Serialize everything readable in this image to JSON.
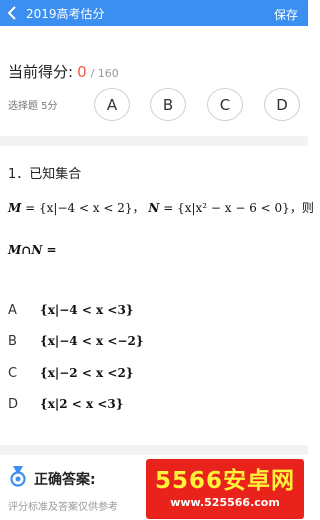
{
  "header": {
    "title": "2019高考估分",
    "save_label": "保存",
    "back_icon": "chevron-left-icon"
  },
  "score": {
    "label": "当前得分:",
    "value": "0",
    "total": "/ 160"
  },
  "question_type": "选择题 5分",
  "option_buttons": [
    "A",
    "B",
    "C",
    "D"
  ],
  "question": {
    "number_text": "1．已知集合",
    "line1": {
      "M": "M",
      "M_set": "= {x|−4 < x < 2}",
      "sep": "，",
      "N": "N",
      "N_set": "= {x|x² − x − 6 < 0}",
      "tail": "，则"
    },
    "line2": "M∩N ="
  },
  "answers": [
    {
      "letter": "A",
      "text": "{x|−4 < x <3}"
    },
    {
      "letter": "B",
      "text": "{x|−4 < x <−2}"
    },
    {
      "letter": "C",
      "text": "{x|−2 < x <2}"
    },
    {
      "letter": "D",
      "text": "{x|2 < x <3}"
    }
  ],
  "correct_answer": {
    "label": "正确答案:",
    "icon": "medal-icon"
  },
  "note": "评分标准及答案仅供参考",
  "watermark": {
    "main": "5566安卓网",
    "url": "www.525566.com"
  },
  "colors": {
    "header_bg": "#3b8ff0",
    "score_accent": "#f3564b",
    "watermark_bg": "#e9231c",
    "watermark_text": "#fff23b"
  }
}
